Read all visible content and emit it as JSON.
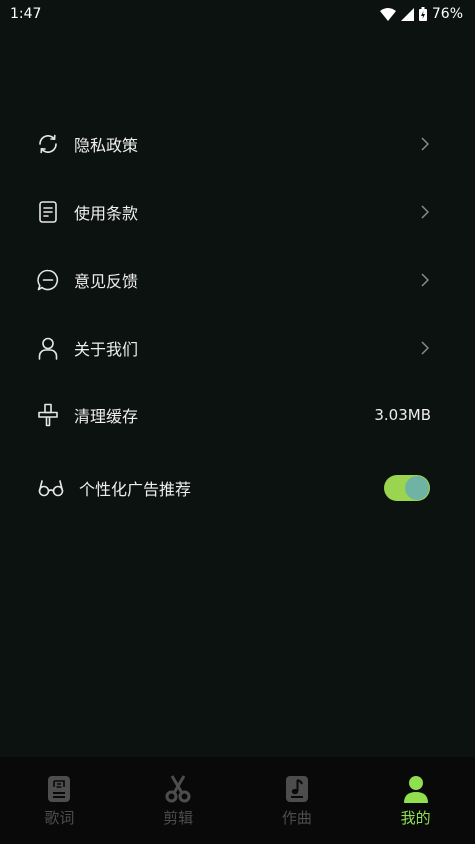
{
  "status_bar": {
    "time": "1:47",
    "battery": "76%"
  },
  "settings": [
    {
      "key": "privacy",
      "label": "隐私政策",
      "icon": "sync-icon",
      "has_chevron": true
    },
    {
      "key": "terms",
      "label": "使用条款",
      "icon": "document-icon",
      "has_chevron": true
    },
    {
      "key": "feedback",
      "label": "意见反馈",
      "icon": "chat-bubble-icon",
      "has_chevron": true
    },
    {
      "key": "about",
      "label": "关于我们",
      "icon": "person-icon",
      "has_chevron": true
    },
    {
      "key": "cache",
      "label": "清理缓存",
      "icon": "brush-icon",
      "value": "3.03MB"
    },
    {
      "key": "ads",
      "label": "个性化广告推荐",
      "icon": "glasses-icon",
      "toggle_on": true
    }
  ],
  "bottom_nav": [
    {
      "label": "歌词",
      "icon": "lyrics-icon",
      "active": false
    },
    {
      "label": "剪辑",
      "icon": "scissors-icon",
      "active": false
    },
    {
      "label": "作曲",
      "icon": "music-note-icon",
      "active": false
    },
    {
      "label": "我的",
      "icon": "profile-icon",
      "active": true
    }
  ],
  "colors": {
    "accent": "#8fdf4f",
    "inactive": "#4d4d4d",
    "background": "#0c120f",
    "nav_background": "#090909"
  }
}
